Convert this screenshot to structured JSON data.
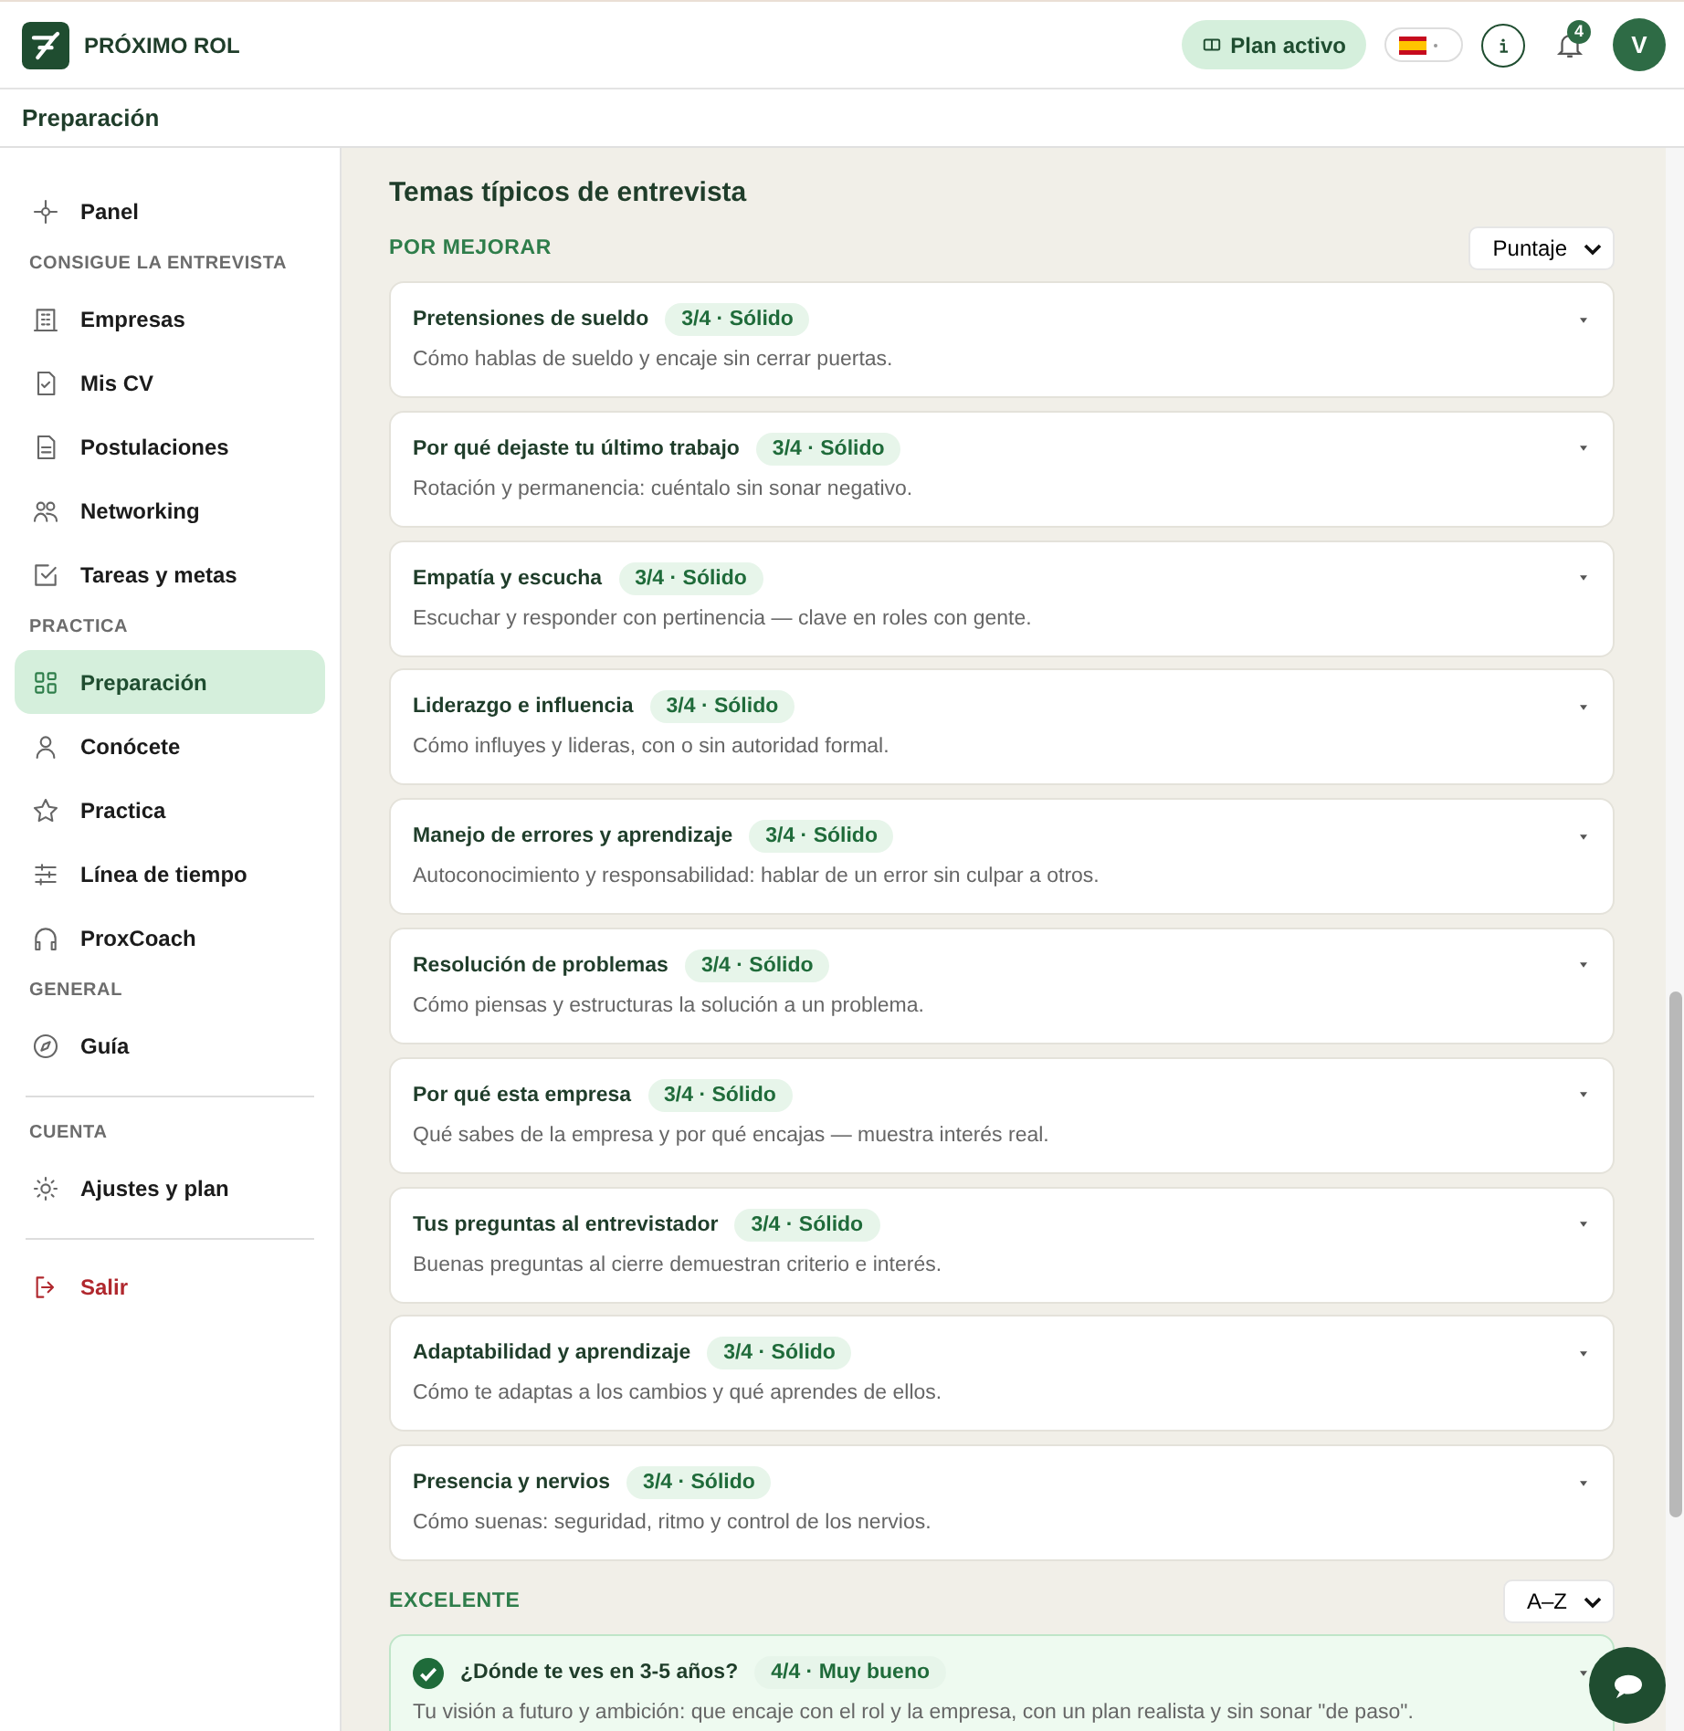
{
  "header": {
    "brand": "PRÓXIMO ROL",
    "plan_button": "Plan activo",
    "notifications_count": "4",
    "avatar_initial": "V"
  },
  "page_title": "Preparación",
  "sidebar": {
    "groups": [
      {
        "kind": "plain",
        "items": [
          {
            "label": "Panel",
            "selected": false,
            "kind": "normal"
          }
        ]
      },
      {
        "kind": "plain",
        "heading": "CONSIGUE LA ENTREVISTA",
        "items": [
          {
            "label": "Empresas",
            "selected": false,
            "kind": "normal"
          },
          {
            "label": "Mis CV",
            "selected": false,
            "kind": "normal"
          },
          {
            "label": "Postulaciones",
            "selected": false,
            "kind": "normal"
          },
          {
            "label": "Networking",
            "selected": false,
            "kind": "normal"
          },
          {
            "label": "Tareas y metas",
            "selected": false,
            "kind": "normal"
          }
        ]
      },
      {
        "kind": "plain",
        "heading": "PRACTICA",
        "items": [
          {
            "label": "Preparación",
            "selected": true,
            "kind": "normal"
          },
          {
            "label": "Conócete",
            "selected": false,
            "kind": "normal"
          },
          {
            "label": "Practica",
            "selected": false,
            "kind": "normal"
          },
          {
            "label": "Línea de tiempo",
            "selected": false,
            "kind": "normal"
          },
          {
            "label": "ProxCoach",
            "selected": false,
            "kind": "normal"
          }
        ]
      },
      {
        "kind": "plain",
        "heading": "GENERAL",
        "items": [
          {
            "label": "Guía",
            "selected": false,
            "kind": "normal"
          }
        ]
      },
      {
        "kind": "separated",
        "heading": "CUENTA",
        "items": [
          {
            "label": "Ajustes y plan",
            "selected": false,
            "kind": "normal"
          }
        ]
      },
      {
        "kind": "separated",
        "items": [
          {
            "label": "Salir",
            "selected": false,
            "kind": "danger"
          }
        ]
      }
    ]
  },
  "main": {
    "title": "Temas típicos de entrevista",
    "sections": [
      {
        "title": "POR MEJORAR",
        "sort": "Puntaje",
        "topics": [
          {
            "title": "Pretensiones de sueldo",
            "score": "3/4 · Sólido",
            "description": "Cómo hablas de sueldo y encaje sin cerrar puertas.",
            "done": false
          },
          {
            "title": "Por qué dejaste tu último trabajo",
            "score": "3/4 · Sólido",
            "description": "Rotación y permanencia: cuéntalo sin sonar negativo.",
            "done": false
          },
          {
            "title": "Empatía y escucha",
            "score": "3/4 · Sólido",
            "description": "Escuchar y responder con pertinencia — clave en roles con gente.",
            "done": false
          },
          {
            "title": "Liderazgo e influencia",
            "score": "3/4 · Sólido",
            "description": "Cómo influyes y lideras, con o sin autoridad formal.",
            "done": false
          },
          {
            "title": "Manejo de errores y aprendizaje",
            "score": "3/4 · Sólido",
            "description": "Autoconocimiento y responsabilidad: hablar de un error sin culpar a otros.",
            "done": false
          },
          {
            "title": "Resolución de problemas",
            "score": "3/4 · Sólido",
            "description": "Cómo piensas y estructuras la solución a un problema.",
            "done": false
          },
          {
            "title": "Por qué esta empresa",
            "score": "3/4 · Sólido",
            "description": "Qué sabes de la empresa y por qué encajas — muestra interés real.",
            "done": false
          },
          {
            "title": "Tus preguntas al entrevistador",
            "score": "3/4 · Sólido",
            "description": "Buenas preguntas al cierre demuestran criterio e interés.",
            "done": false
          },
          {
            "title": "Adaptabilidad y aprendizaje",
            "score": "3/4 · Sólido",
            "description": "Cómo te adaptas a los cambios y qué aprendes de ellos.",
            "done": false
          },
          {
            "title": "Presencia y nervios",
            "score": "3/4 · Sólido",
            "description": "Cómo suenas: seguridad, ritmo y control de los nervios.",
            "done": false
          }
        ]
      },
      {
        "title": "EXCELENTE",
        "sort": "A–Z",
        "topics": [
          {
            "title": "¿Dónde te ves en 3-5 años?",
            "score": "4/4 · Muy bueno",
            "description": "Tu visión a futuro y ambición: que encaje con el rol y la empresa, con un plan realista y sin sonar \"de paso\".",
            "done": true
          }
        ]
      }
    ]
  }
}
